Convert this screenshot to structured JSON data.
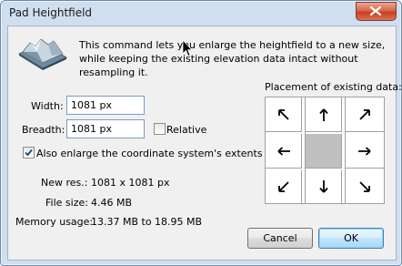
{
  "window": {
    "title": "Pad Heightfield"
  },
  "description": {
    "line1": "This command lets you enlarge the heightfield to a new size,",
    "line2": "while keeping the existing elevation data intact without resampling it."
  },
  "fields": {
    "width_label": "Width:",
    "width_value": "1081 px",
    "breadth_label": "Breadth:",
    "breadth_value": "1081 px",
    "relative_label": "Relative",
    "relative_checked": false,
    "extents_label": "Also enlarge the coordinate system's extents",
    "extents_checked": true
  },
  "info": {
    "new_res_label": "New res.:",
    "new_res_value": "1081 x 1081 px",
    "file_size_label": "File size:",
    "file_size_value": "4.46 MB",
    "memory_label": "Memory usage:",
    "memory_value": "13.37 MB to 18.95 MB"
  },
  "placement": {
    "label": "Placement of existing data:",
    "selected": "center",
    "cells": [
      "top-left-arrow-icon",
      "up-arrow-icon",
      "top-right-arrow-icon",
      "left-arrow-icon",
      "center",
      "right-arrow-icon",
      "bottom-left-arrow-icon",
      "down-arrow-icon",
      "bottom-right-arrow-icon"
    ]
  },
  "buttons": {
    "cancel": "Cancel",
    "ok": "OK"
  },
  "colors": {
    "selected_cell": "#c0c0c0",
    "close_button": "#c7401f",
    "default_button_border": "#3c7fb1"
  }
}
